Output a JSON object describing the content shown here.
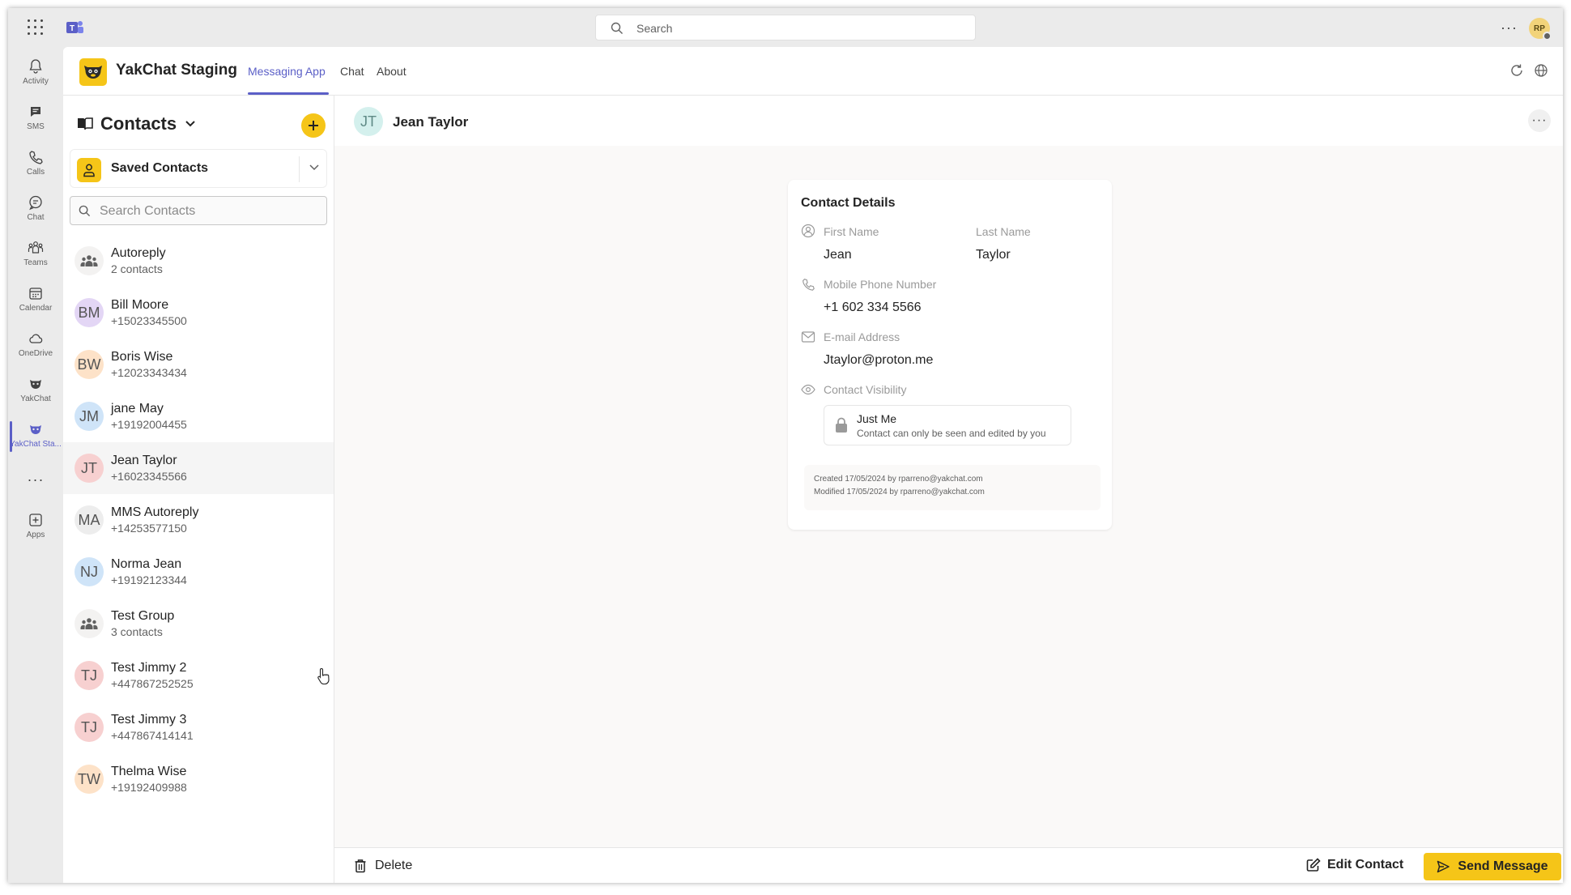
{
  "topbar": {
    "search_placeholder": "Search",
    "user_initials": "RP"
  },
  "rail": [
    {
      "label": "Activity",
      "icon": "bell-icon"
    },
    {
      "label": "SMS",
      "icon": "sms-icon"
    },
    {
      "label": "Calls",
      "icon": "phone-icon"
    },
    {
      "label": "Chat",
      "icon": "chat-icon"
    },
    {
      "label": "Teams",
      "icon": "teams-icon"
    },
    {
      "label": "Calendar",
      "icon": "calendar-icon"
    },
    {
      "label": "OneDrive",
      "icon": "cloud-icon"
    },
    {
      "label": "YakChat",
      "icon": "yakchat-icon"
    },
    {
      "label": "YakChat Sta...",
      "icon": "yakchat-icon",
      "active": true
    },
    {
      "label": "Apps",
      "icon": "apps-icon"
    }
  ],
  "app": {
    "name": "YakChat Staging",
    "tabs": [
      "Messaging App",
      "Chat",
      "About"
    ],
    "active_tab": "Messaging App"
  },
  "contacts_panel": {
    "title": "Contacts",
    "filter_label": "Saved Contacts",
    "search_placeholder": "Search Contacts",
    "items": [
      {
        "name": "Autoreply",
        "sub": "2 contacts",
        "group": true
      },
      {
        "initials": "BM",
        "name": "Bill Moore",
        "sub": "+15023345500",
        "color": "#e3d6f5"
      },
      {
        "initials": "BW",
        "name": "Boris Wise",
        "sub": "+12023343434",
        "color": "#fde2c8"
      },
      {
        "initials": "JM",
        "name": "jane May",
        "sub": "+19192004455",
        "color": "#cfe4f8"
      },
      {
        "initials": "JT",
        "name": "Jean Taylor",
        "sub": "+16023345566",
        "color": "#f7d0d0",
        "selected": true
      },
      {
        "initials": "MA",
        "name": "MMS Autoreply",
        "sub": "+14253577150",
        "color": "#ededed"
      },
      {
        "initials": "NJ",
        "name": "Norma Jean",
        "sub": "+19192123344",
        "color": "#cfe4f8"
      },
      {
        "name": "Test Group",
        "sub": "3 contacts",
        "group": true
      },
      {
        "initials": "TJ",
        "name": "Test Jimmy 2",
        "sub": "+447867252525",
        "color": "#f7d0d0"
      },
      {
        "initials": "TJ",
        "name": "Test Jimmy 3",
        "sub": "+447867414141",
        "color": "#f7d0d0"
      },
      {
        "initials": "TW",
        "name": "Thelma Wise",
        "sub": "+19192409988",
        "color": "#fde2c8"
      }
    ]
  },
  "detail": {
    "initials": "JT",
    "name": "Jean Taylor",
    "card_title": "Contact Details",
    "first_name_label": "First Name",
    "first_name": "Jean",
    "last_name_label": "Last Name",
    "last_name": "Taylor",
    "phone_label": "Mobile Phone Number",
    "phone": "+1 602 334 5566",
    "email_label": "E-mail Address",
    "email": "Jtaylor@proton.me",
    "visibility_label": "Contact Visibility",
    "visibility_title": "Just Me",
    "visibility_desc": "Contact can only be seen and edited by you",
    "created": "Created 17/05/2024 by rparreno@yakchat.com",
    "modified": "Modified 17/05/2024 by rparreno@yakchat.com"
  },
  "footer": {
    "delete_label": "Delete",
    "edit_label": "Edit Contact",
    "send_label": "Send Message"
  },
  "colors": {
    "accent": "#5b5fc7",
    "brand_yellow": "#f5c518"
  }
}
